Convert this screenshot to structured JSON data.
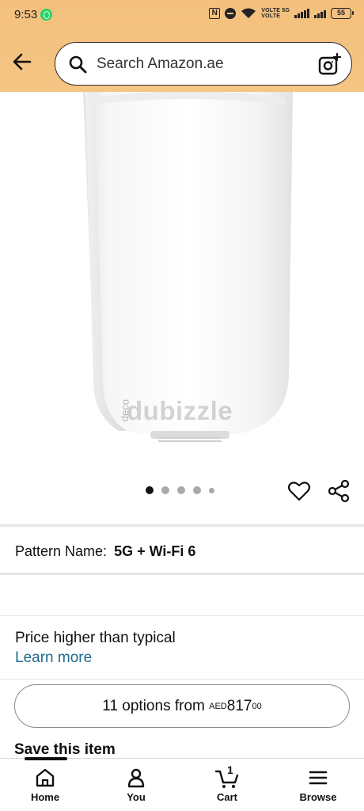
{
  "status_bar": {
    "time": "9:53",
    "volte_1": "VOLTE",
    "volte_2": "VOLTE",
    "network": "5G",
    "battery": "55"
  },
  "header": {
    "search_placeholder": "Search Amazon.ae",
    "accent_color": "#f4c27f"
  },
  "product": {
    "watermark": "dubizzle",
    "image_count": 5,
    "active_image": 1
  },
  "details": {
    "pattern_label": "Pattern Name:",
    "pattern_value": "5G + Wi-Fi 6",
    "price_note": "Price higher than typical",
    "learn_more": "Learn more",
    "options_prefix": "11 options from ",
    "options_currency": "AED",
    "options_price": "817",
    "options_fraction": "00",
    "save_item": "Save this item"
  },
  "bottom_nav": {
    "home": "Home",
    "you": "You",
    "cart": "Cart",
    "cart_count": "1",
    "browse": "Browse"
  }
}
